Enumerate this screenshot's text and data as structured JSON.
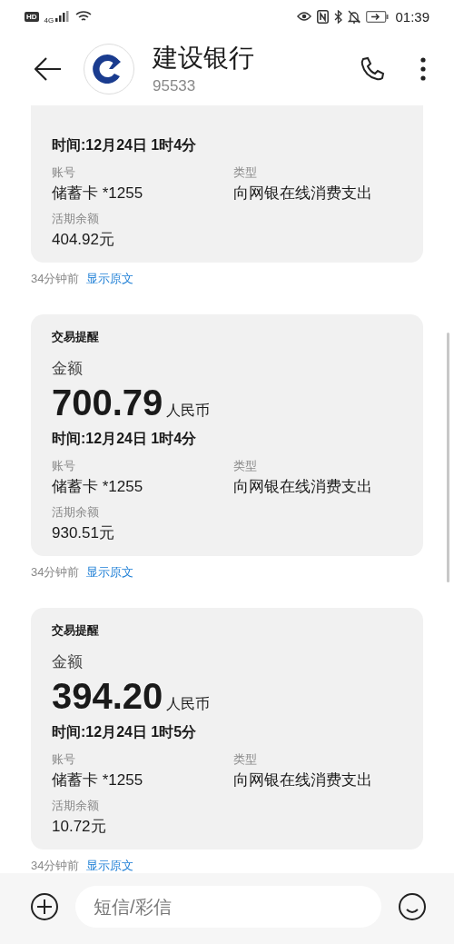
{
  "status_bar": {
    "hd_badge": "HD",
    "network": "4G",
    "time": "01:39"
  },
  "header": {
    "title": "建设银行",
    "subtitle": "95533"
  },
  "messages": [
    {
      "time": "时间:12月24日 1时4分",
      "account_label": "账号",
      "account": "储蓄卡 *1255",
      "type_label": "类型",
      "type": "向网银在线消费支出",
      "balance_label": "活期余额",
      "balance": "404.92元",
      "ago": "34分钟前",
      "show_original": "显示原文"
    },
    {
      "title": "交易提醒",
      "amount_label": "金额",
      "amount": "700.79",
      "currency": "人民币",
      "time": "时间:12月24日 1时4分",
      "account_label": "账号",
      "account": "储蓄卡 *1255",
      "type_label": "类型",
      "type": "向网银在线消费支出",
      "balance_label": "活期余额",
      "balance": "930.51元",
      "ago": "34分钟前",
      "show_original": "显示原文"
    },
    {
      "title": "交易提醒",
      "amount_label": "金额",
      "amount": "394.20",
      "currency": "人民币",
      "time": "时间:12月24日 1时5分",
      "account_label": "账号",
      "account": "储蓄卡 *1255",
      "type_label": "类型",
      "type": "向网银在线消费支出",
      "balance_label": "活期余额",
      "balance": "10.72元",
      "ago": "34分钟前",
      "show_original": "显示原文"
    }
  ],
  "composer": {
    "placeholder": "短信/彩信"
  }
}
